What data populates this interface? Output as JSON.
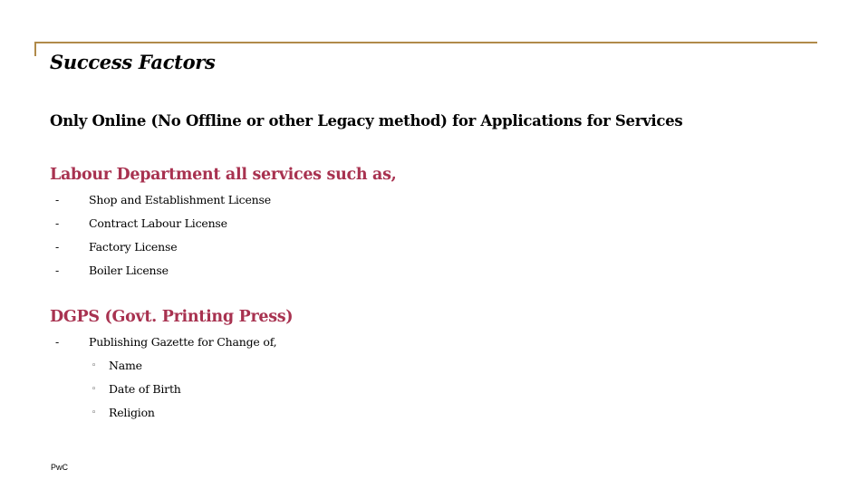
{
  "slide": {
    "title": "Success Factors",
    "intro": "Only Online (No Offline or other Legacy method) for Applications for Services",
    "sections": [
      {
        "heading": "Labour Department all services such as,",
        "items": [
          {
            "marker": "-",
            "text": "Shop and Establishment License"
          },
          {
            "marker": "-",
            "text": "Contract Labour License"
          },
          {
            "marker": "-",
            "text": "Factory License"
          },
          {
            "marker": "-",
            "text": "Boiler License"
          }
        ]
      },
      {
        "heading": "DGPS (Govt. Printing Press)",
        "items": [
          {
            "marker": "-",
            "text": "Publishing Gazette for Change of,",
            "subitems": [
              {
                "marker": "◦",
                "text": "Name"
              },
              {
                "marker": "◦",
                "text": "Date of Birth"
              },
              {
                "marker": "◦",
                "text": "Religion"
              }
            ]
          }
        ]
      }
    ],
    "footer": "PwC",
    "colors": {
      "accent_line": "#b08a4a",
      "section_heading": "#a83250",
      "text": "#000000"
    }
  }
}
